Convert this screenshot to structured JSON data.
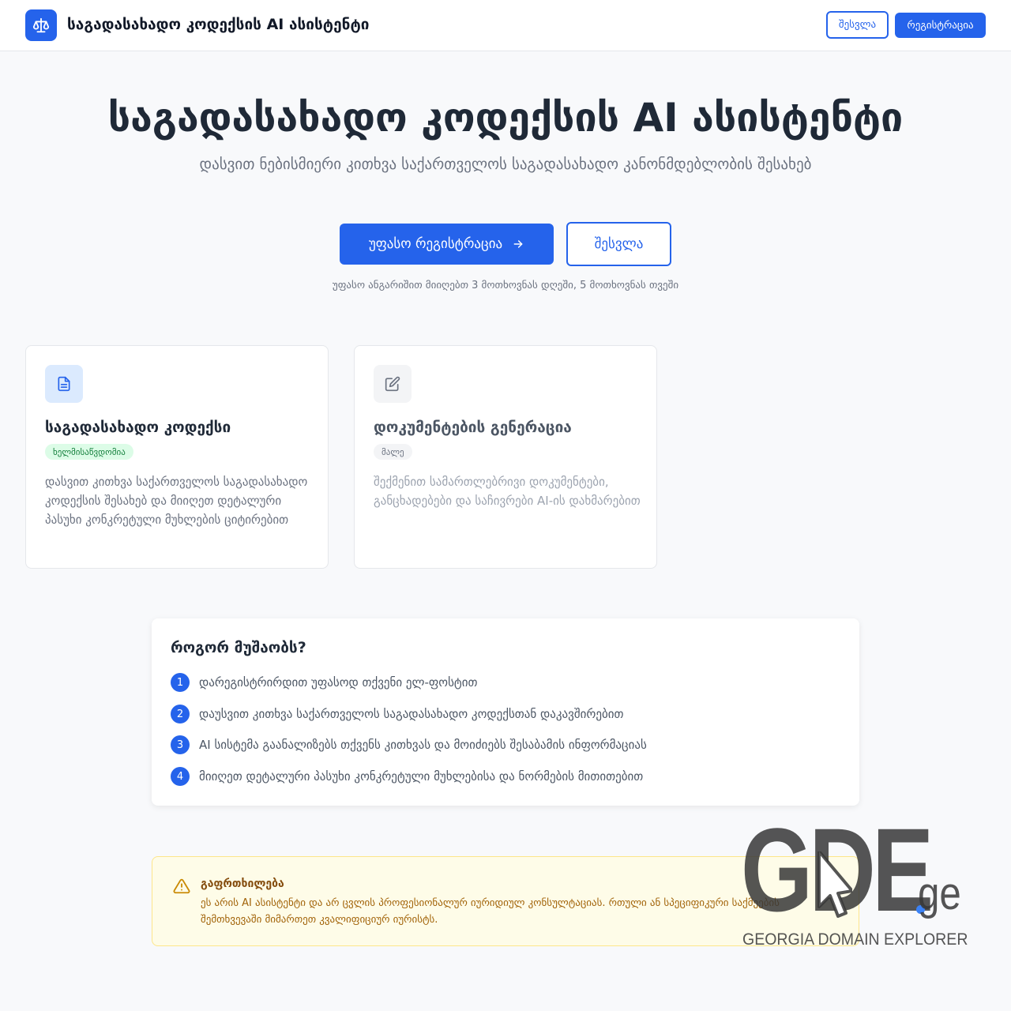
{
  "header": {
    "logo_icon": "scales-icon",
    "title": "საგადასახადო კოდექსის AI ასისტენტი",
    "login_label": "შესვლა",
    "register_label": "რეგისტრაცია"
  },
  "hero": {
    "title": "საგადასახადო კოდექსის AI ასისტენტი",
    "subtitle": "დასვით ნებისმიერი კითხვა საქართველოს საგადასახადო კანონმდებლობის შესახებ",
    "primary_cta": "უფასო რეგისტრაცია",
    "secondary_cta": "შესვლა",
    "note": "უფასო ანგარიშით მიიღებთ 3 მოთხოვნას დღეში, 5 მოთხოვნას თვეში"
  },
  "cards": [
    {
      "icon": "document-icon",
      "title": "საგადასახადო კოდექსი",
      "badge": "ხელმისაწვდომია",
      "description": "დასვით კითხვა საქართველოს საგადასახადო კოდექსის შესახებ და მიიღეთ დეტალური პასუხი კონკრეტული მუხლების ციტირებით"
    },
    {
      "icon": "edit-icon",
      "title": "დოკუმენტების გენერაცია",
      "badge": "მალე",
      "description": "შექმენით სამართლებრივი დოკუმენტები, განცხადებები და საჩივრები AI-ის დახმარებით"
    }
  ],
  "how": {
    "title": "როგორ მუშაობს?",
    "steps": [
      {
        "num": "1",
        "text": "დარეგისტრირდით უფასოდ თქვენი ელ-ფოსტით"
      },
      {
        "num": "2",
        "text": "დაუსვით კითხვა საქართველოს საგადასახადო კოდექსთან დაკავშირებით"
      },
      {
        "num": "3",
        "text": "AI სისტემა გაანალიზებს თქვენს კითხვას და მოიძიებს შესაბამის ინფორმაციას"
      },
      {
        "num": "4",
        "text": "მიიღეთ დეტალური პასუხი კონკრეტული მუხლებისა და ნორმების მითითებით"
      }
    ]
  },
  "warning": {
    "icon": "warning-triangle-icon",
    "title": "გაფრთხილება",
    "text": "ეს არის AI ასისტენტი და არ ცვლის პროფესიონალურ იურიდიულ კონსულტაციას. რთული ან სპეციფიკური საქმეების შემთხვევაში მიმართეთ კვალიფიციურ იურისტს."
  },
  "watermark": {
    "brand": "GDE",
    "tld": "ge",
    "tagline": "GEORGIA DOMAIN EXPLORER"
  },
  "colors": {
    "accent": "#2563eb",
    "success_badge_bg": "#dcfce7",
    "success_badge_text": "#15803d",
    "warning_bg": "#fefce8",
    "warning_text": "#a16207"
  }
}
